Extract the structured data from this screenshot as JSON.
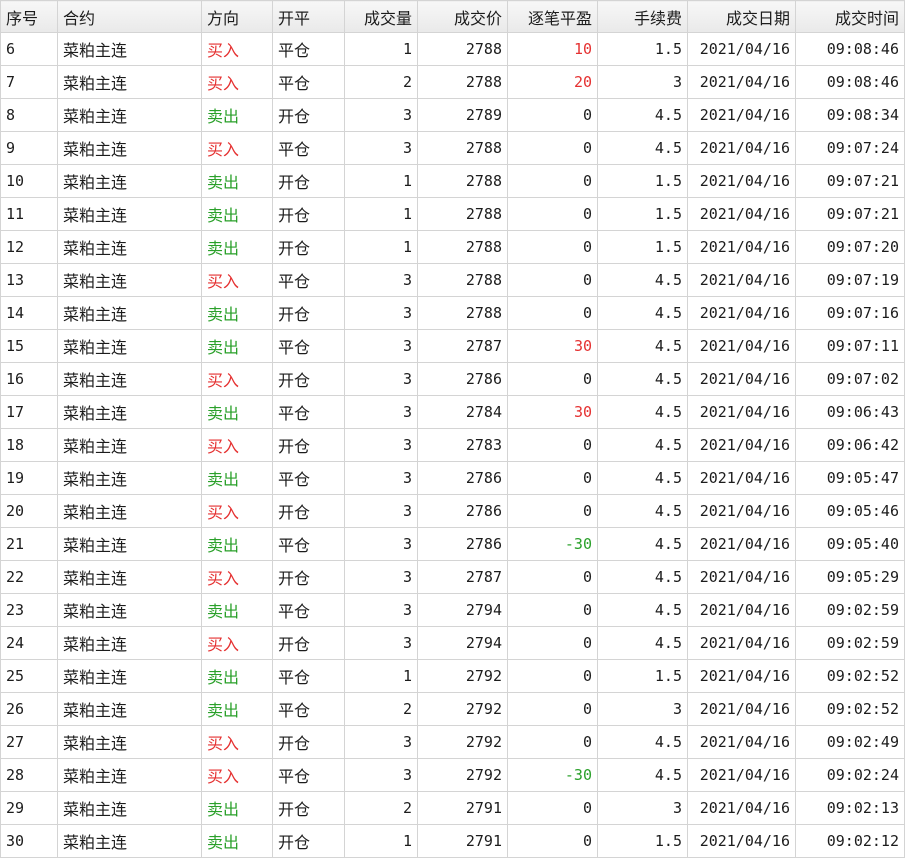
{
  "columns": [
    "序号",
    "合约",
    "方向",
    "开平",
    "成交量",
    "成交价",
    "逐笔平盈",
    "手续费",
    "成交日期",
    "成交时间"
  ],
  "colors": {
    "buy": "#e53131",
    "sell": "#2aa02a",
    "profit": "#e53131",
    "loss": "#2aa02a"
  },
  "rows": [
    [
      "6",
      "菜粕主连",
      "买入",
      "平仓",
      "1",
      "2788",
      "10",
      "1.5",
      "2021/04/16",
      "09:08:46"
    ],
    [
      "7",
      "菜粕主连",
      "买入",
      "平仓",
      "2",
      "2788",
      "20",
      "3",
      "2021/04/16",
      "09:08:46"
    ],
    [
      "8",
      "菜粕主连",
      "卖出",
      "开仓",
      "3",
      "2789",
      "0",
      "4.5",
      "2021/04/16",
      "09:08:34"
    ],
    [
      "9",
      "菜粕主连",
      "买入",
      "平仓",
      "3",
      "2788",
      "0",
      "4.5",
      "2021/04/16",
      "09:07:24"
    ],
    [
      "10",
      "菜粕主连",
      "卖出",
      "开仓",
      "1",
      "2788",
      "0",
      "1.5",
      "2021/04/16",
      "09:07:21"
    ],
    [
      "11",
      "菜粕主连",
      "卖出",
      "开仓",
      "1",
      "2788",
      "0",
      "1.5",
      "2021/04/16",
      "09:07:21"
    ],
    [
      "12",
      "菜粕主连",
      "卖出",
      "开仓",
      "1",
      "2788",
      "0",
      "1.5",
      "2021/04/16",
      "09:07:20"
    ],
    [
      "13",
      "菜粕主连",
      "买入",
      "平仓",
      "3",
      "2788",
      "0",
      "4.5",
      "2021/04/16",
      "09:07:19"
    ],
    [
      "14",
      "菜粕主连",
      "卖出",
      "开仓",
      "3",
      "2788",
      "0",
      "4.5",
      "2021/04/16",
      "09:07:16"
    ],
    [
      "15",
      "菜粕主连",
      "卖出",
      "平仓",
      "3",
      "2787",
      "30",
      "4.5",
      "2021/04/16",
      "09:07:11"
    ],
    [
      "16",
      "菜粕主连",
      "买入",
      "开仓",
      "3",
      "2786",
      "0",
      "4.5",
      "2021/04/16",
      "09:07:02"
    ],
    [
      "17",
      "菜粕主连",
      "卖出",
      "平仓",
      "3",
      "2784",
      "30",
      "4.5",
      "2021/04/16",
      "09:06:43"
    ],
    [
      "18",
      "菜粕主连",
      "买入",
      "开仓",
      "3",
      "2783",
      "0",
      "4.5",
      "2021/04/16",
      "09:06:42"
    ],
    [
      "19",
      "菜粕主连",
      "卖出",
      "平仓",
      "3",
      "2786",
      "0",
      "4.5",
      "2021/04/16",
      "09:05:47"
    ],
    [
      "20",
      "菜粕主连",
      "买入",
      "开仓",
      "3",
      "2786",
      "0",
      "4.5",
      "2021/04/16",
      "09:05:46"
    ],
    [
      "21",
      "菜粕主连",
      "卖出",
      "平仓",
      "3",
      "2786",
      "-30",
      "4.5",
      "2021/04/16",
      "09:05:40"
    ],
    [
      "22",
      "菜粕主连",
      "买入",
      "开仓",
      "3",
      "2787",
      "0",
      "4.5",
      "2021/04/16",
      "09:05:29"
    ],
    [
      "23",
      "菜粕主连",
      "卖出",
      "平仓",
      "3",
      "2794",
      "0",
      "4.5",
      "2021/04/16",
      "09:02:59"
    ],
    [
      "24",
      "菜粕主连",
      "买入",
      "开仓",
      "3",
      "2794",
      "0",
      "4.5",
      "2021/04/16",
      "09:02:59"
    ],
    [
      "25",
      "菜粕主连",
      "卖出",
      "平仓",
      "1",
      "2792",
      "0",
      "1.5",
      "2021/04/16",
      "09:02:52"
    ],
    [
      "26",
      "菜粕主连",
      "卖出",
      "平仓",
      "2",
      "2792",
      "0",
      "3",
      "2021/04/16",
      "09:02:52"
    ],
    [
      "27",
      "菜粕主连",
      "买入",
      "开仓",
      "3",
      "2792",
      "0",
      "4.5",
      "2021/04/16",
      "09:02:49"
    ],
    [
      "28",
      "菜粕主连",
      "买入",
      "平仓",
      "3",
      "2792",
      "-30",
      "4.5",
      "2021/04/16",
      "09:02:24"
    ],
    [
      "29",
      "菜粕主连",
      "卖出",
      "开仓",
      "2",
      "2791",
      "0",
      "3",
      "2021/04/16",
      "09:02:13"
    ],
    [
      "30",
      "菜粕主连",
      "卖出",
      "开仓",
      "1",
      "2791",
      "0",
      "1.5",
      "2021/04/16",
      "09:02:12"
    ]
  ]
}
